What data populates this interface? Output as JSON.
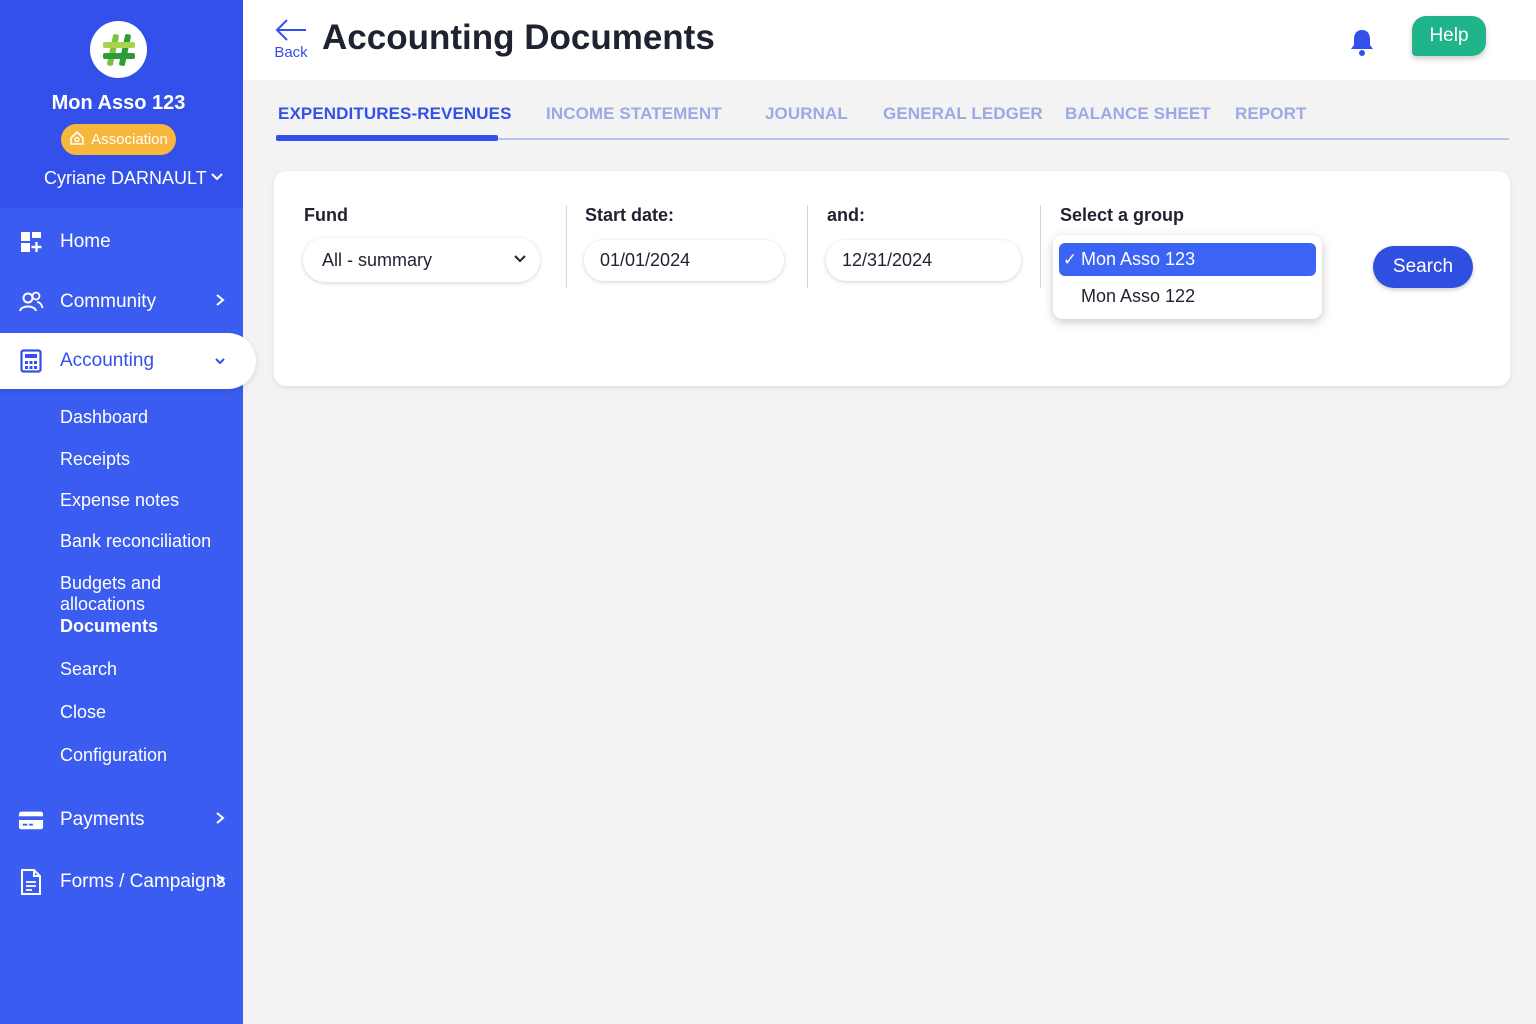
{
  "sidebar": {
    "org_name": "Mon Asso 123",
    "badge": "Association",
    "user": "Cyriane DARNAULT",
    "nav": [
      {
        "label": "Home",
        "icon": "dashboard-grid-icon"
      },
      {
        "label": "Community",
        "icon": "users-icon"
      },
      {
        "label": "Accounting",
        "icon": "calculator-icon"
      }
    ],
    "accounting_sub": [
      "Dashboard",
      "Receipts",
      "Expense notes",
      "Bank reconciliation",
      "Budgets and allocations",
      "Documents",
      "Search",
      "Close",
      "Configuration"
    ],
    "nav_bottom": [
      {
        "label": "Payments",
        "icon": "credit-card-icon"
      },
      {
        "label": "Forms / Campaigns",
        "icon": "document-icon"
      }
    ]
  },
  "header": {
    "back_label": "Back",
    "title": "Accounting Documents",
    "help_label": "Help"
  },
  "tabs": [
    "EXPENDITURES-REVENUES",
    "INCOME STATEMENT",
    "JOURNAL",
    "GENERAL LEDGER",
    "BALANCE SHEET",
    "REPORT"
  ],
  "filters": {
    "fund_label": "Fund",
    "fund_value": "All - summary",
    "start_label": "Start date:",
    "start_value": "01/01/2024",
    "end_label": "and:",
    "end_value": "12/31/2024",
    "group_label": "Select a group",
    "group_options": [
      "Mon Asso 123",
      "Mon Asso 122"
    ],
    "search_label": "Search"
  },
  "colors": {
    "sidebar": "#3b5cf0",
    "primary": "#3351ea",
    "badge": "#f6b73c",
    "help": "#1fb489"
  }
}
